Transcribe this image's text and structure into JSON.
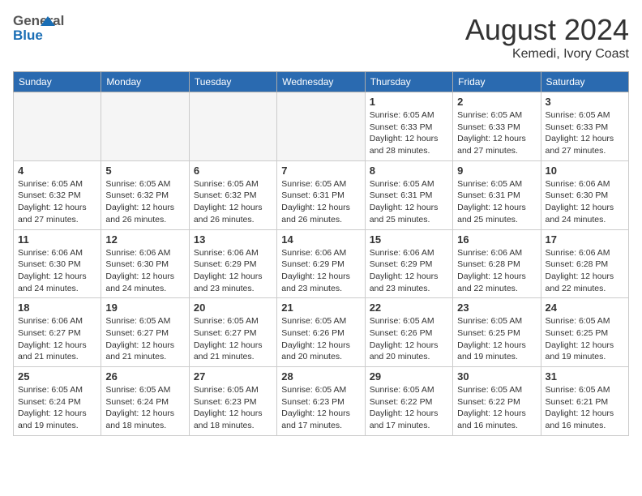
{
  "header": {
    "logo_general": "General",
    "logo_blue": "Blue",
    "month_year": "August 2024",
    "location": "Kemedi, Ivory Coast"
  },
  "days_of_week": [
    "Sunday",
    "Monday",
    "Tuesday",
    "Wednesday",
    "Thursday",
    "Friday",
    "Saturday"
  ],
  "weeks": [
    [
      {
        "day": "",
        "info": ""
      },
      {
        "day": "",
        "info": ""
      },
      {
        "day": "",
        "info": ""
      },
      {
        "day": "",
        "info": ""
      },
      {
        "day": "1",
        "info": "Sunrise: 6:05 AM\nSunset: 6:33 PM\nDaylight: 12 hours and 28 minutes."
      },
      {
        "day": "2",
        "info": "Sunrise: 6:05 AM\nSunset: 6:33 PM\nDaylight: 12 hours and 27 minutes."
      },
      {
        "day": "3",
        "info": "Sunrise: 6:05 AM\nSunset: 6:33 PM\nDaylight: 12 hours and 27 minutes."
      }
    ],
    [
      {
        "day": "4",
        "info": "Sunrise: 6:05 AM\nSunset: 6:32 PM\nDaylight: 12 hours and 27 minutes."
      },
      {
        "day": "5",
        "info": "Sunrise: 6:05 AM\nSunset: 6:32 PM\nDaylight: 12 hours and 26 minutes."
      },
      {
        "day": "6",
        "info": "Sunrise: 6:05 AM\nSunset: 6:32 PM\nDaylight: 12 hours and 26 minutes."
      },
      {
        "day": "7",
        "info": "Sunrise: 6:05 AM\nSunset: 6:31 PM\nDaylight: 12 hours and 26 minutes."
      },
      {
        "day": "8",
        "info": "Sunrise: 6:05 AM\nSunset: 6:31 PM\nDaylight: 12 hours and 25 minutes."
      },
      {
        "day": "9",
        "info": "Sunrise: 6:05 AM\nSunset: 6:31 PM\nDaylight: 12 hours and 25 minutes."
      },
      {
        "day": "10",
        "info": "Sunrise: 6:06 AM\nSunset: 6:30 PM\nDaylight: 12 hours and 24 minutes."
      }
    ],
    [
      {
        "day": "11",
        "info": "Sunrise: 6:06 AM\nSunset: 6:30 PM\nDaylight: 12 hours and 24 minutes."
      },
      {
        "day": "12",
        "info": "Sunrise: 6:06 AM\nSunset: 6:30 PM\nDaylight: 12 hours and 24 minutes."
      },
      {
        "day": "13",
        "info": "Sunrise: 6:06 AM\nSunset: 6:29 PM\nDaylight: 12 hours and 23 minutes."
      },
      {
        "day": "14",
        "info": "Sunrise: 6:06 AM\nSunset: 6:29 PM\nDaylight: 12 hours and 23 minutes."
      },
      {
        "day": "15",
        "info": "Sunrise: 6:06 AM\nSunset: 6:29 PM\nDaylight: 12 hours and 23 minutes."
      },
      {
        "day": "16",
        "info": "Sunrise: 6:06 AM\nSunset: 6:28 PM\nDaylight: 12 hours and 22 minutes."
      },
      {
        "day": "17",
        "info": "Sunrise: 6:06 AM\nSunset: 6:28 PM\nDaylight: 12 hours and 22 minutes."
      }
    ],
    [
      {
        "day": "18",
        "info": "Sunrise: 6:06 AM\nSunset: 6:27 PM\nDaylight: 12 hours and 21 minutes."
      },
      {
        "day": "19",
        "info": "Sunrise: 6:05 AM\nSunset: 6:27 PM\nDaylight: 12 hours and 21 minutes."
      },
      {
        "day": "20",
        "info": "Sunrise: 6:05 AM\nSunset: 6:27 PM\nDaylight: 12 hours and 21 minutes."
      },
      {
        "day": "21",
        "info": "Sunrise: 6:05 AM\nSunset: 6:26 PM\nDaylight: 12 hours and 20 minutes."
      },
      {
        "day": "22",
        "info": "Sunrise: 6:05 AM\nSunset: 6:26 PM\nDaylight: 12 hours and 20 minutes."
      },
      {
        "day": "23",
        "info": "Sunrise: 6:05 AM\nSunset: 6:25 PM\nDaylight: 12 hours and 19 minutes."
      },
      {
        "day": "24",
        "info": "Sunrise: 6:05 AM\nSunset: 6:25 PM\nDaylight: 12 hours and 19 minutes."
      }
    ],
    [
      {
        "day": "25",
        "info": "Sunrise: 6:05 AM\nSunset: 6:24 PM\nDaylight: 12 hours and 19 minutes."
      },
      {
        "day": "26",
        "info": "Sunrise: 6:05 AM\nSunset: 6:24 PM\nDaylight: 12 hours and 18 minutes."
      },
      {
        "day": "27",
        "info": "Sunrise: 6:05 AM\nSunset: 6:23 PM\nDaylight: 12 hours and 18 minutes."
      },
      {
        "day": "28",
        "info": "Sunrise: 6:05 AM\nSunset: 6:23 PM\nDaylight: 12 hours and 17 minutes."
      },
      {
        "day": "29",
        "info": "Sunrise: 6:05 AM\nSunset: 6:22 PM\nDaylight: 12 hours and 17 minutes."
      },
      {
        "day": "30",
        "info": "Sunrise: 6:05 AM\nSunset: 6:22 PM\nDaylight: 12 hours and 16 minutes."
      },
      {
        "day": "31",
        "info": "Sunrise: 6:05 AM\nSunset: 6:21 PM\nDaylight: 12 hours and 16 minutes."
      }
    ]
  ]
}
